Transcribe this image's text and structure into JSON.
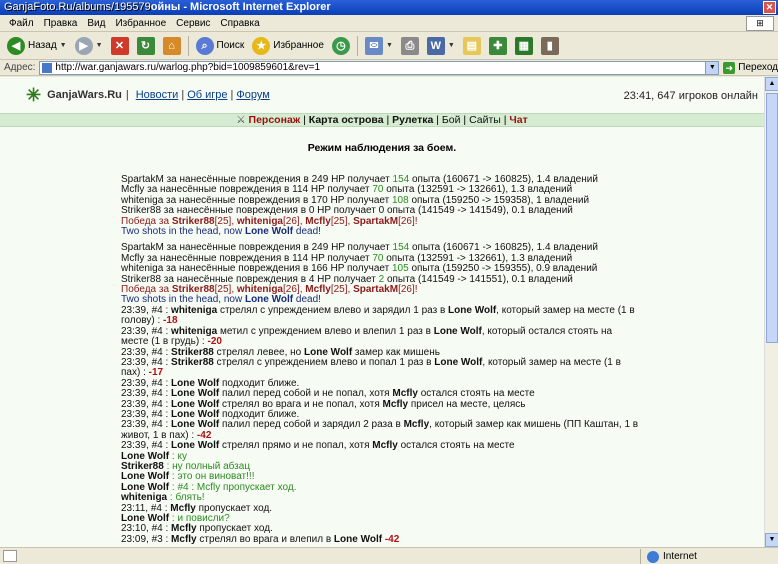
{
  "watermark": "GanjaFoto.Ru/albums/195579",
  "window": {
    "title": "ойны - Microsoft Internet Explorer"
  },
  "menu": [
    "Файл",
    "Правка",
    "Вид",
    "Избранное",
    "Сервис",
    "Справка"
  ],
  "toolbar": {
    "back": "Назад",
    "search": "Поиск",
    "favorites": "Избранное"
  },
  "address": {
    "label": "Адрес:",
    "url": "http://war.ganjawars.ru/warlog.php?bid=1009859601&rev=1",
    "go": "Переход"
  },
  "status": {
    "zone": "Internet"
  },
  "site": {
    "name": "GanjaWars.Ru",
    "sep1": "·",
    "nav": [
      "Новости",
      "Об игре",
      "Форум"
    ],
    "online": "23:41, 647 игроков онлайн",
    "subnav": [
      "Персонаж",
      "Карта острова",
      "Рулетка",
      "Бой",
      "Сайты",
      "Чат"
    ]
  },
  "mode_title": "Режим наблюдения за боем.",
  "log": {
    "b1": [
      {
        "name": "SpartakM",
        "hp": "249",
        "exp": "154",
        "range": "(160671 -> 160825)",
        "own": "1.4 владений"
      },
      {
        "name": "Mcfly",
        "hp": "114",
        "exp": "70",
        "range": "(132591 -> 132661)",
        "own": "1.3 владений"
      },
      {
        "name": "whiteniga",
        "hp": "170",
        "exp": "108",
        "range": "(159250 -> 159358)",
        "own": "1 владений"
      },
      {
        "name": "Striker88",
        "hp": "0",
        "exp": "0",
        "range": "(141549 -> 141549)",
        "own": "0.1 владений"
      }
    ],
    "b2": [
      {
        "name": "SpartakM",
        "hp": "249",
        "exp": "154",
        "range": "(160671 -> 160825)",
        "own": "1.4 владений"
      },
      {
        "name": "Mcfly",
        "hp": "114",
        "exp": "70",
        "range": "(132591 -> 132661)",
        "own": "1.3 владений"
      },
      {
        "name": "whiteniga",
        "hp": "166",
        "exp": "105",
        "range": "(159250 -> 159355)",
        "own": "0.9 владений"
      },
      {
        "name": "Striker88",
        "hp": "4",
        "exp": "2",
        "range": "(141549 -> 141551)",
        "own": "0.1 владений"
      }
    ],
    "dmg_pre": "за нанесённые повреждения в",
    "hp_word": "HP получает",
    "exp_word": "опыта",
    "victory": "Победа за",
    "v1": "Striker88",
    "v1l": "[25]",
    "v2": "whiteniga",
    "v2l": "[26]",
    "v3": "Mcfly",
    "v3l": "[25]",
    "v4": "SpartakM",
    "v4l": "[26]",
    "shots_pre": "Two shots in the head, now",
    "lone": "Lone Wolf",
    "dead": "dead!",
    "e1a": "23:39, #4 : ",
    "e1n": "whiteniga",
    "e1t": " стрелял с упреждением влево и зарядил 1 раз в ",
    "e1v": "Lone Wolf",
    "e1t2": ", который замер на месте (1 в голову) : ",
    "e1d": "-18",
    "e2a": "23:39, #4 : ",
    "e2n": "whiteniga",
    "e2t": " метил с упреждением влево и влепил 1 раз в ",
    "e2v": "Lone Wolf",
    "e2t2": ", который остался стоять на месте (1 в грудь) : ",
    "e2d": "-20",
    "e3a": "23:39, #4 : ",
    "e3n": "Striker88",
    "e3t": " стрелял левее, но ",
    "e3v": "Lone Wolf",
    "e3t2": " замер как мишень",
    "e4a": "23:39, #4 : ",
    "e4n": "Striker88",
    "e4t": " стрелял с упреждением влево и попал 1 раз в ",
    "e4v": "Lone Wolf",
    "e4t2": ", который замер на месте (1 в пах) : ",
    "e4d": "-17",
    "e5a": "23:39, #4 : ",
    "e5n": "Lone Wolf",
    "e5t": " подходит ближе.",
    "e6a": "23:39, #4 : ",
    "e6n": "Lone Wolf",
    "e6t": " палил перед собой и не попал, хотя ",
    "e6v": "Mcfly",
    "e6t2": " остался стоять на месте",
    "e7a": "23:39, #4 : ",
    "e7n": "Lone Wolf",
    "e7t": " стрелял во врага и не попал, хотя ",
    "e7v": "Mcfly",
    "e7t2": " присел на месте, целясь",
    "e8a": "23:39, #4 : ",
    "e8n": "Lone Wolf",
    "e8t": " подходит ближе.",
    "e9a": "23:39, #4 : ",
    "e9n": "Lone Wolf",
    "e9t": " палил перед собой и зарядил 2 раза в ",
    "e9v": "Mcfly",
    "e9t2": ", который замер как мишень (ПП Каштан, 1 в живот, 1 в пах) : ",
    "e9d": "-42",
    "e10a": "23:39, #4 : ",
    "e10n": "Lone Wolf",
    "e10t": " стрелял прямо и не попал, хотя ",
    "e10v": "Mcfly",
    "e10t2": " остался стоять на месте",
    "c1n": "Lone Wolf",
    "c1t": ": ку",
    "c2n": "Striker88",
    "c2t": ": ну полный абзац",
    "c3n": "Lone Wolf",
    "c3t": ": это он виноват!!!",
    "c4n": "Lone Wolf",
    "c4t": ": #4 : Mcfly пропускает ход.",
    "c5n": "whiteniga",
    "c5t": ": блять!",
    "e11a": "23:11, #4 : ",
    "e11n": "Mcfly",
    "e11t": " пропускает ход.",
    "c6n": "Lone Wolf",
    "c6t": ": и повисли?",
    "e12a": "23:10, #4 : ",
    "e12n": "Mcfly",
    "e12t": " пропускает ход.",
    "e13a": "23:09, #3 : ",
    "e13n": "Mcfly",
    "e13t": " стрелял во врага и влепил в ",
    "e13v": "Lone Wolf",
    "e13d": " -42"
  }
}
